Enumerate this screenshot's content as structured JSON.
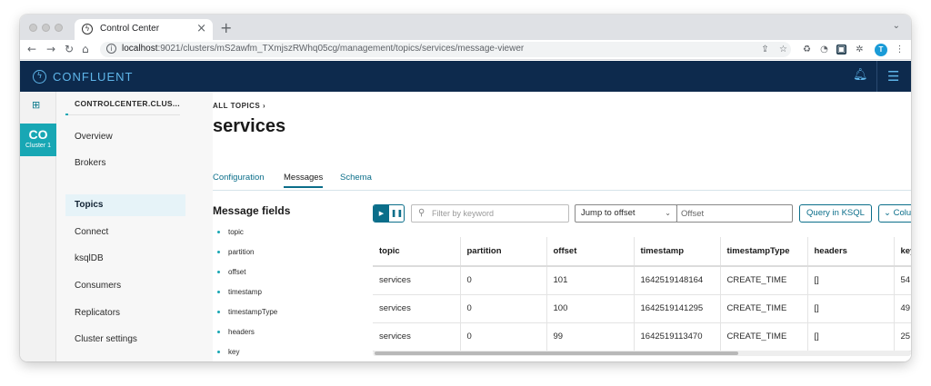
{
  "browser": {
    "tab_title": "Control Center",
    "url_host": "localhost",
    "url_path": ":9021/clusters/mS2awfm_TXmjszRWhq05cg/management/topics/services/message-viewer",
    "profile_initial": "T"
  },
  "app": {
    "brand": "CONFLUENT",
    "accent": "#18a7b4",
    "header_bg": "#0d2a4d"
  },
  "rail": {
    "cluster_abbr": "CO",
    "cluster_label": "Cluster 1"
  },
  "sidebar": {
    "cluster_name": "CONTROLCENTER.CLUS...",
    "items": [
      {
        "label": "Overview"
      },
      {
        "label": "Brokers"
      },
      {
        "label": "Topics"
      },
      {
        "label": "Connect"
      },
      {
        "label": "ksqlDB"
      },
      {
        "label": "Consumers"
      },
      {
        "label": "Replicators"
      },
      {
        "label": "Cluster settings"
      }
    ]
  },
  "main": {
    "breadcrumb": "ALL TOPICS ›",
    "title": "services",
    "tabs": [
      {
        "label": "Configuration"
      },
      {
        "label": "Messages"
      },
      {
        "label": "Schema"
      }
    ],
    "message_fields": {
      "title": "Message fields",
      "items": [
        "topic",
        "partition",
        "offset",
        "timestamp",
        "timestampType",
        "headers",
        "key"
      ]
    },
    "toolbar": {
      "filter_placeholder": "Filter by keyword",
      "jump_label": "Jump to offset",
      "offset_placeholder": "Offset",
      "ksql_label": "Query in KSQL",
      "columns_label": "Colu"
    },
    "table": {
      "headers": [
        "topic",
        "partition",
        "offset",
        "timestamp",
        "timestampType",
        "headers",
        "key"
      ],
      "rows": [
        [
          "services",
          "0",
          "101",
          "1642519148164",
          "CREATE_TIME",
          "[]",
          "54"
        ],
        [
          "services",
          "0",
          "100",
          "1642519141295",
          "CREATE_TIME",
          "[]",
          "49"
        ],
        [
          "services",
          "0",
          "99",
          "1642519113470",
          "CREATE_TIME",
          "[]",
          "25"
        ]
      ]
    }
  }
}
